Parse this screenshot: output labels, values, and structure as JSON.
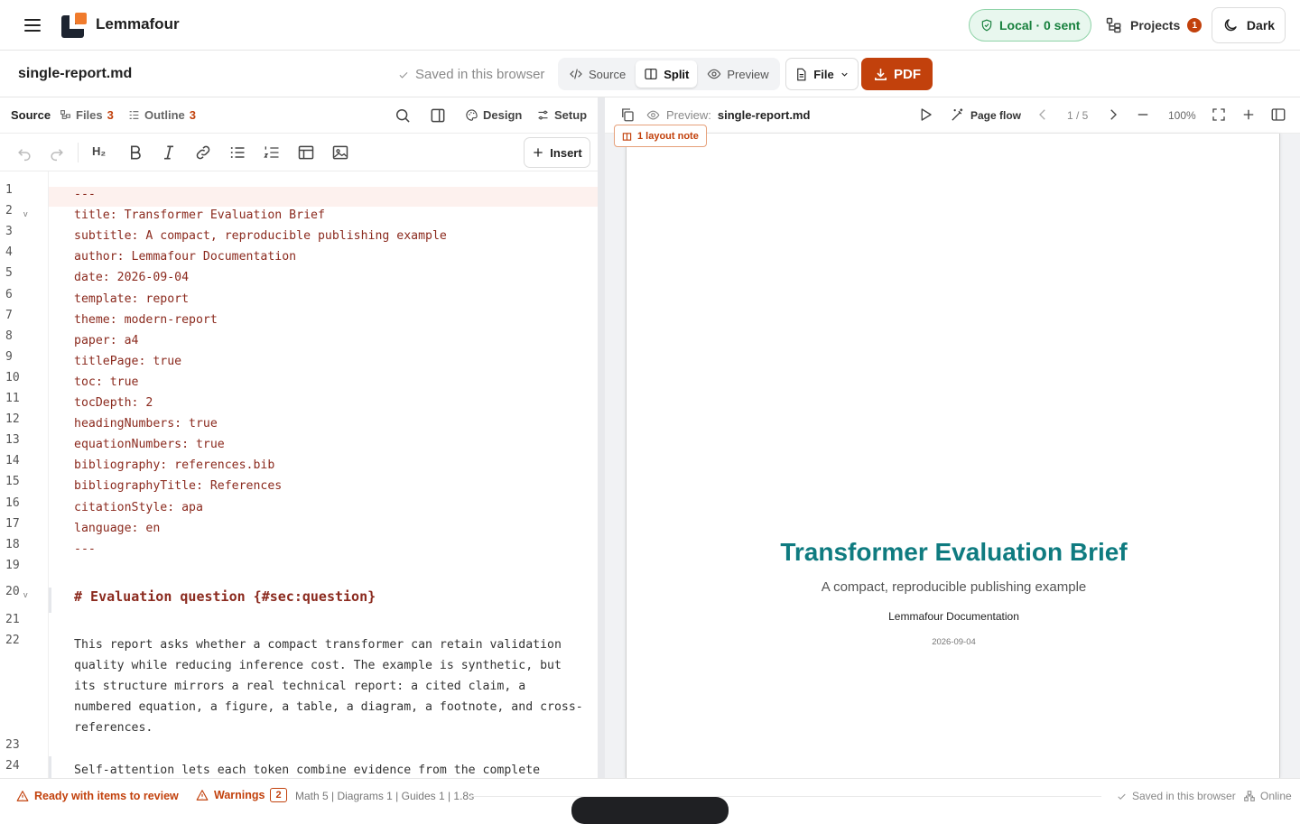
{
  "app": {
    "name": "Lemmafour"
  },
  "topbar": {
    "local_status": "Local · 0 sent",
    "projects_label": "Projects",
    "projects_count": "1",
    "theme_label": "Dark"
  },
  "docbar": {
    "filename": "single-report.md",
    "saved_status": "Saved in this browser",
    "views": [
      {
        "label": "Source",
        "active": false
      },
      {
        "label": "Split",
        "active": true
      },
      {
        "label": "Preview",
        "active": false
      }
    ],
    "file_label": "File",
    "pdf_label": "PDF"
  },
  "left_pane": {
    "tabs": [
      {
        "label": "Source"
      },
      {
        "label": "Files",
        "count": "3"
      },
      {
        "label": "Outline",
        "count": "3"
      }
    ],
    "design_label": "Design",
    "setup_label": "Setup",
    "insert_label": "Insert",
    "lines": [
      {
        "n": "1",
        "text": "---"
      },
      {
        "n": "2",
        "text": "title: Transformer Evaluation Brief",
        "fold": "v"
      },
      {
        "n": "3",
        "text": "subtitle: A compact, reproducible publishing example"
      },
      {
        "n": "4",
        "text": "author: Lemmafour Documentation"
      },
      {
        "n": "5",
        "text": "date: 2026-09-04"
      },
      {
        "n": "6",
        "text": "template: report"
      },
      {
        "n": "7",
        "text": "theme: modern-report"
      },
      {
        "n": "8",
        "text": "paper: a4"
      },
      {
        "n": "9",
        "text": "titlePage: true"
      },
      {
        "n": "10",
        "text": "toc: true"
      },
      {
        "n": "11",
        "text": "tocDepth: 2"
      },
      {
        "n": "12",
        "text": "headingNumbers: true"
      },
      {
        "n": "13",
        "text": "equationNumbers: true"
      },
      {
        "n": "14",
        "text": "bibliography: references.bib"
      },
      {
        "n": "15",
        "text": "bibliographyTitle: References"
      },
      {
        "n": "16",
        "text": "citationStyle: apa"
      },
      {
        "n": "17",
        "text": "language: en"
      },
      {
        "n": "18",
        "text": "---"
      },
      {
        "n": "19",
        "text": ""
      },
      {
        "n": "20",
        "text": "# Evaluation question {#sec:question}",
        "fold": "v"
      },
      {
        "n": "21",
        "text": ""
      },
      {
        "n": "22",
        "text": "This report asks whether a compact transformer can retain validation\nquality while reducing inference cost. The example is synthetic, but\nits structure mirrors a real technical report: a cited claim, a\nnumbered equation, a figure, a table, a diagram, a footnote, and cross-\nreferences."
      },
      {
        "n": "23",
        "text": ""
      },
      {
        "n": "24",
        "text": "Self-attention lets each token combine evidence from the complete"
      }
    ]
  },
  "right_pane": {
    "preview_prefix": "Preview:",
    "preview_file": "single-report.md",
    "page_flow_label": "Page flow",
    "page_indicator": "1 / 5",
    "zoom": "100%",
    "layout_note": "1 layout note",
    "document": {
      "title": "Transformer Evaluation Brief",
      "subtitle": "A compact, reproducible publishing example",
      "author": "Lemmafour Documentation",
      "date": "2026-09-04"
    }
  },
  "statusbar": {
    "ready": "Ready with items to review",
    "warnings_label": "Warnings",
    "warnings_count": "2",
    "stats": "Math 5 | Diagrams 1 | Guides 1 | 1.8s",
    "saved": "Saved in this browser",
    "online": "Online"
  },
  "colors": {
    "accent": "#c2410c",
    "success": "#17803d",
    "title_teal": "#0f7b80",
    "code_red": "#8b2a1e"
  }
}
